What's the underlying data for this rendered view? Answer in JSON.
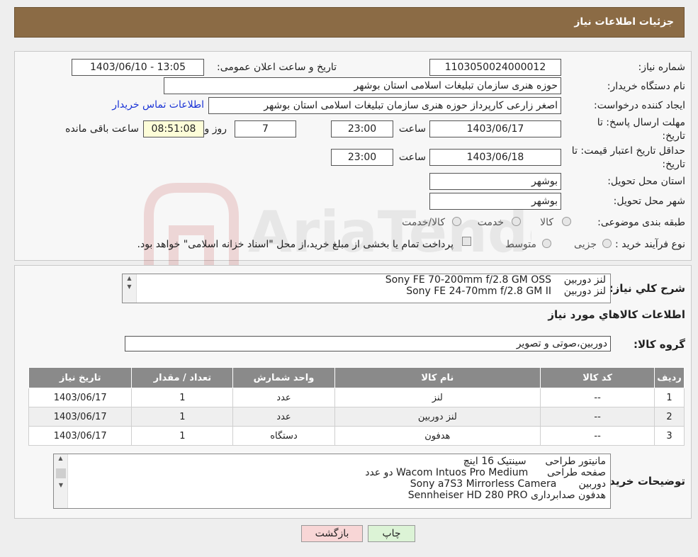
{
  "header": {
    "title": "جزئیات اطلاعات نیاز"
  },
  "form": {
    "need_number_label": "شماره نیاز:",
    "need_number": "1103050024000012",
    "announce_label": "تاریخ و ساعت اعلان عمومی:",
    "announce_value": "1403/06/10 - 13:05",
    "buyer_org_label": "نام دستگاه خریدار:",
    "buyer_org": "حوزه هنری سازمان تبلیغات اسلامی استان بوشهر",
    "creator_label": "ایجاد کننده درخواست:",
    "creator": "اصغر زارعی کارپرداز حوزه هنری سازمان تبلیغات اسلامی استان بوشهر",
    "contact_link": "اطلاعات تماس خریدار",
    "reply_deadline_label_1": "مهلت ارسال پاسخ: تا",
    "reply_deadline_label_2": "تاریخ:",
    "reply_date": "1403/06/17",
    "time_label": "ساعت",
    "reply_time": "23:00",
    "days_value": "7",
    "days_label": "روز و",
    "remaining_time": "08:51:08",
    "remaining_label": "ساعت باقی مانده",
    "price_validity_label_1": "حداقل تاریخ اعتبار قیمت: تا",
    "price_validity_label_2": "تاریخ:",
    "validity_date": "1403/06/18",
    "validity_time": "23:00",
    "province_label": "استان محل تحویل:",
    "province": "بوشهر",
    "city_label": "شهر محل تحویل:",
    "city": "بوشهر",
    "category_label": "طبقه بندی موضوعی:",
    "category_options": [
      "کالا",
      "خدمت",
      "کالا/خدمت"
    ],
    "process_label": "نوع فرآیند خرید :",
    "process_options": [
      "جزیی",
      "متوسط"
    ],
    "process_note": "پرداخت تمام یا بخشی از مبلغ خرید،از محل \"اسناد خزانه اسلامی\" خواهد بود."
  },
  "summary": {
    "label": "شرح کلي نياز:",
    "lines": [
      "لنز دوربین    Sony FE 70-200mm f/2.8 GM OSS",
      "لنز دوربین    Sony FE 24-70mm f/2.8 GM II"
    ]
  },
  "goods": {
    "section_title": "اطلاعات كالاهاي مورد نياز",
    "group_label": "گروه کالا:",
    "group_value": "دوربین،صوتی و تصویر"
  },
  "table": {
    "headers": [
      "رديف",
      "کد کالا",
      "نام کالا",
      "واحد شمارش",
      "تعداد / مقدار",
      "تاریخ نیاز"
    ],
    "rows": [
      [
        "1",
        "--",
        "لنز",
        "عدد",
        "1",
        "1403/06/17"
      ],
      [
        "2",
        "--",
        "لنز دوربین",
        "عدد",
        "1",
        "1403/06/17"
      ],
      [
        "3",
        "--",
        "هدفون",
        "دستگاه",
        "1",
        "1403/06/17"
      ]
    ]
  },
  "buyer_notes": {
    "label": "توضیحات خریدار:",
    "lines": [
      "مانیتور طراحی      سینتیک 16 اینچ",
      "صفحه طراحی      Wacom Intuos Pro Medium دو عدد",
      "دوربین       Sony a7S3 Mirrorless Camera",
      "هدفون صدابرداری Sennheiser HD 280 PRO"
    ]
  },
  "buttons": {
    "print": "چاپ",
    "back": "بازگشت"
  },
  "watermark": {
    "text": "AriaTender.neT"
  },
  "colors": {
    "header": "#8b6b45",
    "table_header": "#8a8a8a",
    "link": "#1a33d6",
    "back_button": "#f8d6d6",
    "print_button": "#dcf3d6"
  }
}
